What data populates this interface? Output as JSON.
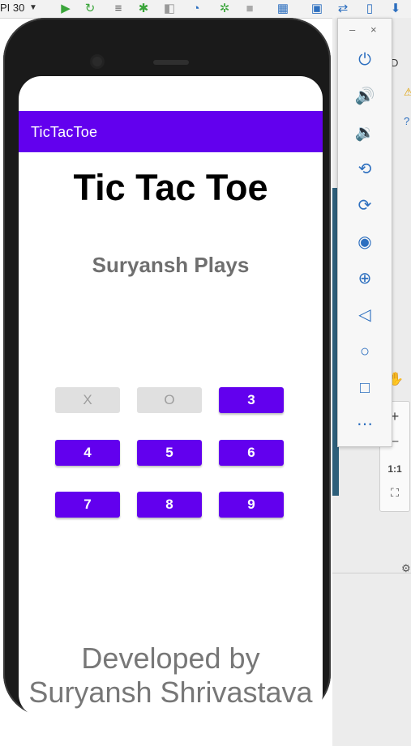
{
  "ide": {
    "api_label": "PI 30",
    "right_frag_d": "D",
    "zoom_plus": "+",
    "zoom_minus": "–",
    "zoom_ratio": "1:1"
  },
  "emulator": {
    "minimize": "–",
    "close": "×"
  },
  "app": {
    "appbar_title": "TicTacToe",
    "heading": "Tic Tac Toe",
    "turn_text": "Suryansh Plays",
    "cells": [
      "X",
      "O",
      "3",
      "4",
      "5",
      "6",
      "7",
      "8",
      "9"
    ],
    "footer_line1": "Developed by",
    "footer_line2": "Suryansh Shrivastava"
  },
  "colors": {
    "primary": "#6200ee",
    "disabled_bg": "#e0e0e0",
    "disabled_text": "#9e9e9e"
  }
}
